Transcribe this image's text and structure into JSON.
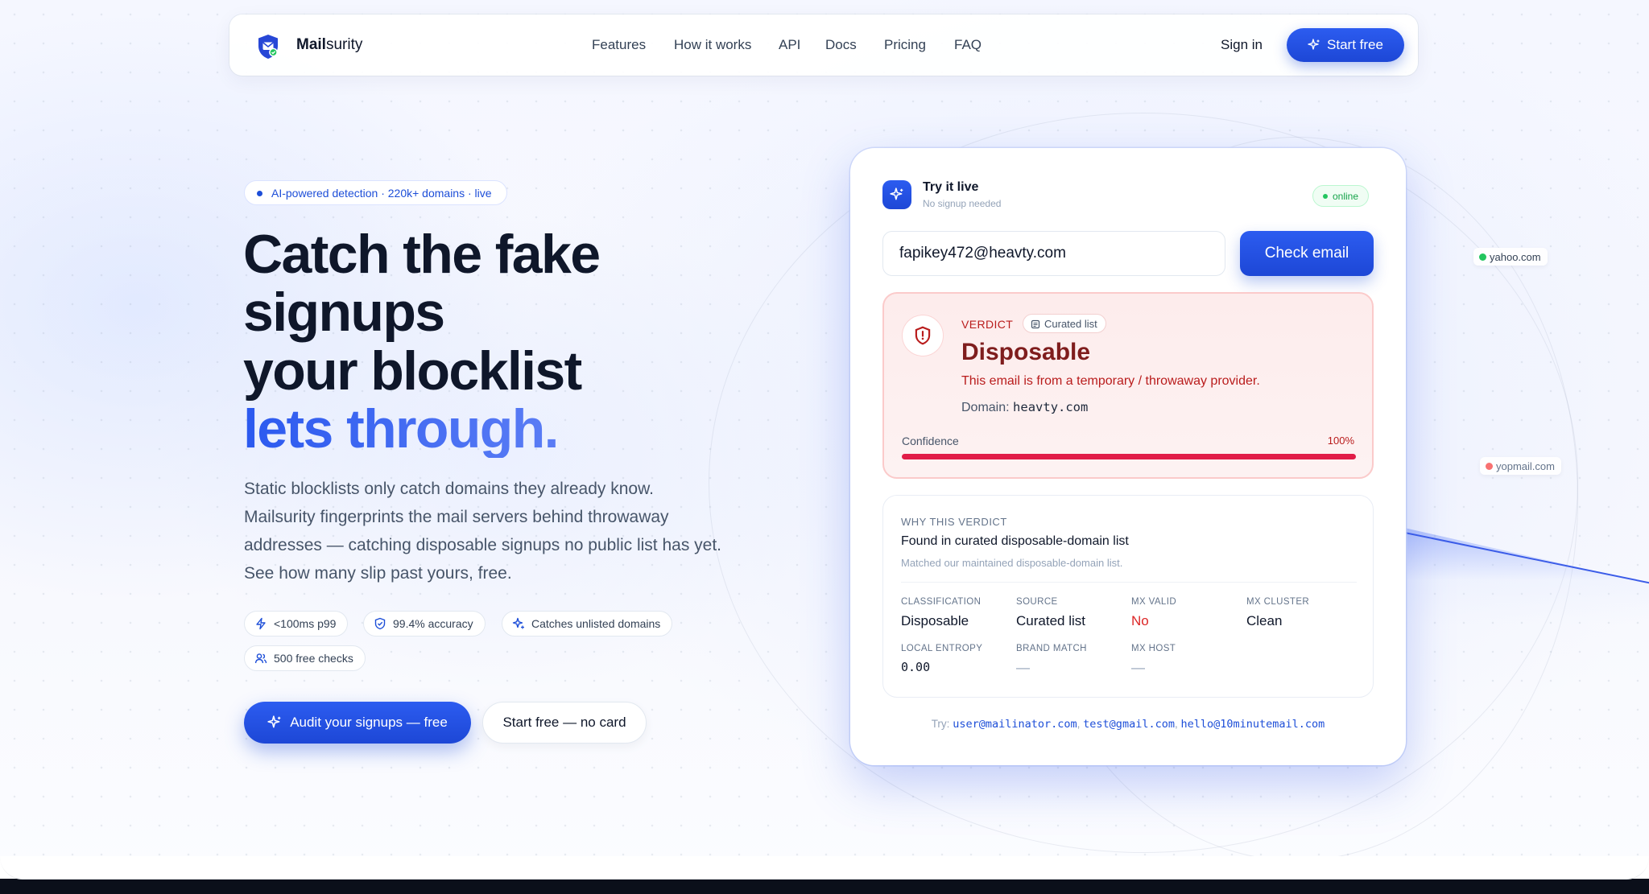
{
  "brand": {
    "name_bold": "Mail",
    "name_light": "surity"
  },
  "nav": {
    "links": [
      "Features",
      "How it works",
      "API",
      "Docs",
      "Pricing",
      "FAQ"
    ],
    "signin": "Sign in",
    "start_free": "Start free"
  },
  "hero": {
    "pill": "AI-powered detection · 220k+ domains · live",
    "headline_lines": [
      "Catch the fake",
      "signups",
      "your blocklist"
    ],
    "headline_accent": "lets through.",
    "lead": "Static blocklists only catch domains they already know. Mailsurity fingerprints the mail servers behind throwaway addresses — catching disposable signups no public list has yet. See how many slip past yours, free.",
    "chips": [
      "<100ms p99",
      "99.4% accuracy",
      "Catches unlisted domains",
      "500 free checks"
    ],
    "cta_primary": "Audit your signups — free",
    "cta_secondary": "Start free — no card"
  },
  "demo": {
    "title": "Try it live",
    "subtitle": "No signup needed",
    "status": "online",
    "input_value": "fapikey472@heavty.com",
    "check_button": "Check email",
    "verdict": {
      "label": "VERDICT",
      "source_badge": "Curated list",
      "result": "Disposable",
      "description": "This email is from a temporary / throwaway provider.",
      "domain_label": "Domain:",
      "domain": "heavty.com",
      "confidence_label": "Confidence",
      "confidence_text": "100%",
      "confidence": 1.0
    },
    "why": {
      "heading": "WHY THIS VERDICT",
      "main": "Found in curated disposable-domain list",
      "sub": "Matched our maintained disposable-domain list.",
      "stats": [
        {
          "key": "CLASSIFICATION",
          "value": "Disposable"
        },
        {
          "key": "SOURCE",
          "value": "Curated list"
        },
        {
          "key": "MX VALID",
          "value": "No"
        },
        {
          "key": "MX CLUSTER",
          "value": "Clean"
        },
        {
          "key": "LOCAL ENTROPY",
          "value": "0.00"
        },
        {
          "key": "BRAND MATCH",
          "value": "—"
        },
        {
          "key": "MX HOST",
          "value": "—"
        }
      ]
    },
    "try_label": "Try:",
    "examples": [
      "user@mailinator.com",
      "test@gmail.com",
      "hello@10minutemail.com"
    ]
  },
  "floating_domains": [
    {
      "name": "yahoo.com",
      "color": "#22c55e"
    },
    {
      "name": "yopmail.com",
      "color": "#f87171"
    }
  ],
  "colors": {
    "accent": "#1d4ed8",
    "danger": "#dc2626",
    "success": "#22c55e"
  }
}
